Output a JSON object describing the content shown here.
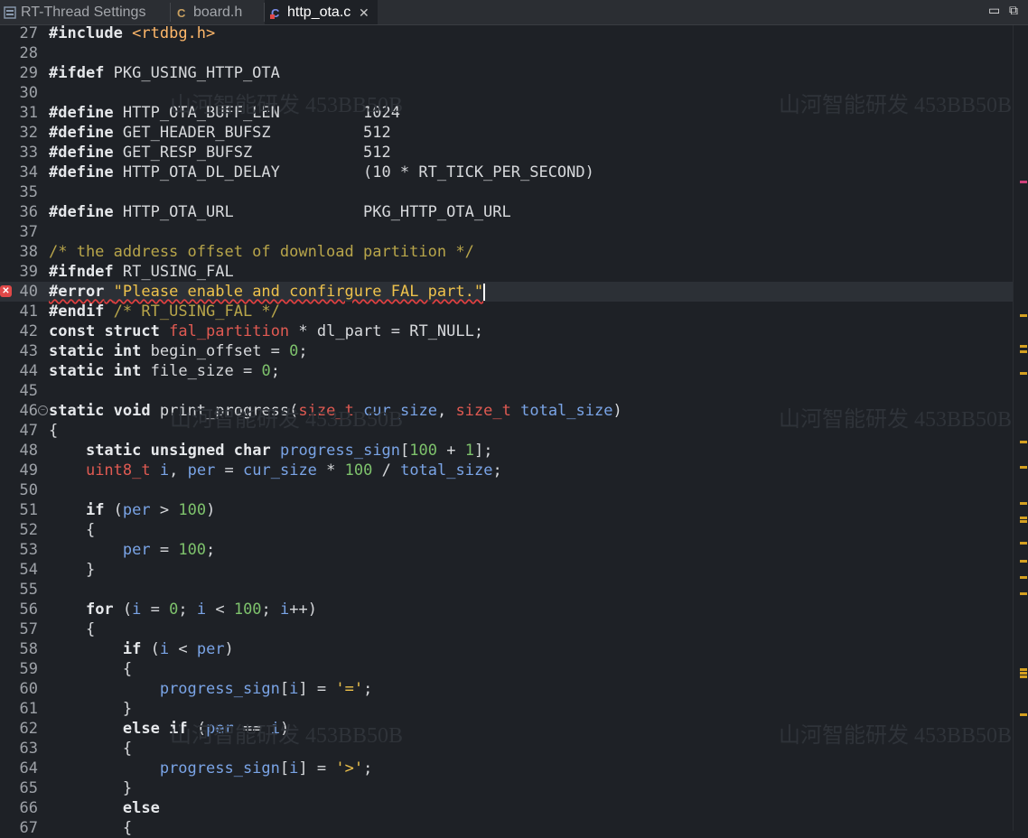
{
  "tabs": [
    {
      "label": "RT-Thread Settings",
      "icon": "settings-icon",
      "active": false
    },
    {
      "label": "board.h",
      "icon": "c-header-icon",
      "active": false
    },
    {
      "label": "http_ota.c",
      "icon": "c-source-error-icon",
      "active": true
    }
  ],
  "watermark": "山河智能研发 453BB50B",
  "current_line": 40,
  "error_line": 40,
  "fold_lines": [
    46
  ],
  "colors": {
    "background": "#1e2126",
    "keyword": "#e6e8eb",
    "string": "#eec24c",
    "comment": "#b8a54a",
    "number": "#7ec26c",
    "type": "#e05a52",
    "variable": "#7aa4e6",
    "error": "#e04848"
  },
  "lines": [
    {
      "n": "27",
      "t": "#include <rtdbg.h>"
    },
    {
      "n": "28",
      "t": ""
    },
    {
      "n": "29",
      "t": "#ifdef PKG_USING_HTTP_OTA"
    },
    {
      "n": "30",
      "t": ""
    },
    {
      "n": "31",
      "t": "#define HTTP_OTA_BUFF_LEN         1024"
    },
    {
      "n": "32",
      "t": "#define GET_HEADER_BUFSZ          512"
    },
    {
      "n": "33",
      "t": "#define GET_RESP_BUFSZ            512"
    },
    {
      "n": "34",
      "t": "#define HTTP_OTA_DL_DELAY         (10 * RT_TICK_PER_SECOND)"
    },
    {
      "n": "35",
      "t": ""
    },
    {
      "n": "36",
      "t": "#define HTTP_OTA_URL              PKG_HTTP_OTA_URL"
    },
    {
      "n": "37",
      "t": ""
    },
    {
      "n": "38",
      "t": "/* the address offset of download partition */"
    },
    {
      "n": "39",
      "t": "#ifndef RT_USING_FAL"
    },
    {
      "n": "40",
      "t": "#error \"Please enable and confirgure FAL part.\""
    },
    {
      "n": "41",
      "t": "#endif /* RT_USING_FAL */"
    },
    {
      "n": "42",
      "t": "const struct fal_partition * dl_part = RT_NULL;"
    },
    {
      "n": "43",
      "t": "static int begin_offset = 0;"
    },
    {
      "n": "44",
      "t": "static int file_size = 0;"
    },
    {
      "n": "45",
      "t": ""
    },
    {
      "n": "46",
      "t": "static void print_progress(size_t cur_size, size_t total_size)"
    },
    {
      "n": "47",
      "t": "{"
    },
    {
      "n": "48",
      "t": "    static unsigned char progress_sign[100 + 1];"
    },
    {
      "n": "49",
      "t": "    uint8_t i, per = cur_size * 100 / total_size;"
    },
    {
      "n": "50",
      "t": ""
    },
    {
      "n": "51",
      "t": "    if (per > 100)"
    },
    {
      "n": "52",
      "t": "    {"
    },
    {
      "n": "53",
      "t": "        per = 100;"
    },
    {
      "n": "54",
      "t": "    }"
    },
    {
      "n": "55",
      "t": ""
    },
    {
      "n": "56",
      "t": "    for (i = 0; i < 100; i++)"
    },
    {
      "n": "57",
      "t": "    {"
    },
    {
      "n": "58",
      "t": "        if (i < per)"
    },
    {
      "n": "59",
      "t": "        {"
    },
    {
      "n": "60",
      "t": "            progress_sign[i] = '=';"
    },
    {
      "n": "61",
      "t": "        }"
    },
    {
      "n": "62",
      "t": "        else if (per == i)"
    },
    {
      "n": "63",
      "t": "        {"
    },
    {
      "n": "64",
      "t": "            progress_sign[i] = '>';"
    },
    {
      "n": "65",
      "t": "        }"
    },
    {
      "n": "66",
      "t": "        else"
    },
    {
      "n": "67",
      "t": "        {"
    }
  ]
}
